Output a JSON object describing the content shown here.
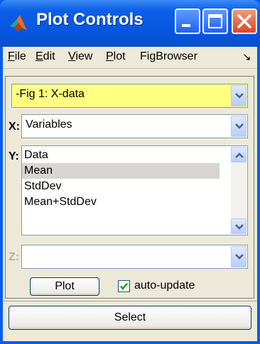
{
  "window": {
    "title": "Plot Controls",
    "icon": "matlab-logo-icon",
    "controls": [
      "minimize-icon",
      "maximize-icon",
      "close-icon"
    ]
  },
  "menu": {
    "items": [
      {
        "label": "File",
        "mnemonic": "F",
        "rest": "ile"
      },
      {
        "label": "Edit",
        "mnemonic": "E",
        "rest": "dit"
      },
      {
        "label": "View",
        "mnemonic": "V",
        "rest": "iew"
      },
      {
        "label": "Plot",
        "mnemonic": "P",
        "rest": "lot"
      },
      {
        "label": "FigBrowser",
        "mnemonic": "",
        "rest": "FigBrowser"
      }
    ],
    "overflow_glyph": "↘"
  },
  "figure_selector": {
    "value": "-Fig 1: X-data",
    "highlight_color": "#ffff80"
  },
  "x_axis": {
    "label": "X:",
    "value": "Variables"
  },
  "y_axis": {
    "label": "Y:",
    "items": [
      "Data",
      "Mean",
      "StdDev",
      "Mean+StdDev"
    ],
    "selected": "Mean"
  },
  "z_axis": {
    "label": "Z:",
    "value": "",
    "enabled": false
  },
  "actions": {
    "plot_label": "Plot",
    "auto_update_label": "auto-update",
    "auto_update_checked": true,
    "select_label": "Select"
  },
  "colors": {
    "titlebar": "#0755e0",
    "face": "#ece9d8",
    "close": "#d8462a",
    "check": "#21a121"
  }
}
